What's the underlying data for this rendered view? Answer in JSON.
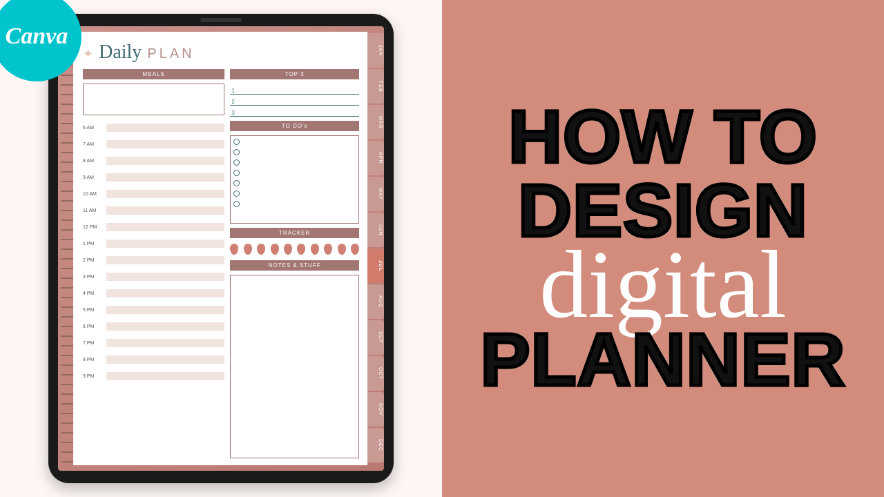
{
  "badge": {
    "label": "Canva"
  },
  "planner": {
    "title": {
      "script": "Daily",
      "plain": "PLAN"
    },
    "sections": {
      "meals": "MEALS",
      "top3": "TOP 3",
      "todos": "TO DO's",
      "tracker": "TRACKER",
      "notes": "NOTES & STUFF"
    },
    "hours": [
      "6 AM",
      "7 AM",
      "8 AM",
      "9 AM",
      "10 AM",
      "11 AM",
      "12 PM",
      "1 PM",
      "2 PM",
      "3 PM",
      "4 PM",
      "5 PM",
      "6 PM",
      "7 PM",
      "8 PM",
      "9 PM"
    ],
    "top3_numbers": [
      "1",
      "2",
      "3"
    ],
    "todo_count": 7,
    "tracker_drops": 10,
    "tabs": [
      "JAN",
      "FEB",
      "MAR",
      "APR",
      "MAY",
      "JUN",
      "JUL",
      "AUG",
      "SEP",
      "OCT",
      "NOV",
      "DEC"
    ],
    "active_tab": "JUL"
  },
  "headline": {
    "line1": "HOW TO",
    "line2": "DESIGN",
    "line3": "digital",
    "line4": "PLANNER"
  }
}
